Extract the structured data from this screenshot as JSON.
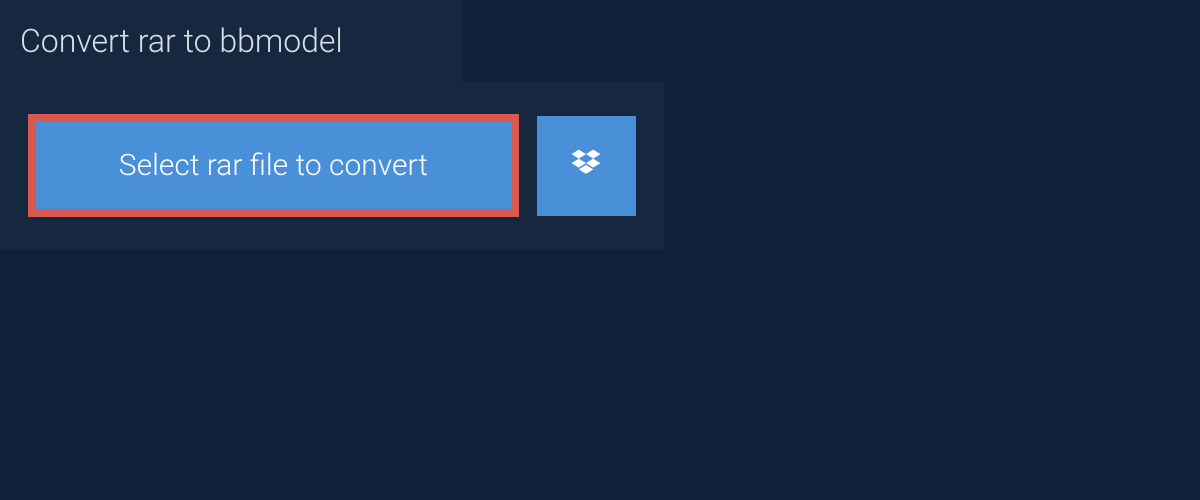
{
  "header": {
    "title": "Convert rar to bbmodel"
  },
  "upload": {
    "select_label": "Select rar file to convert"
  },
  "colors": {
    "background": "#0f2139",
    "panel": "#16283f",
    "button": "#4a90d9",
    "highlight_border": "#d9584f",
    "text_light": "#d8dfe6",
    "text_white": "#ffffff"
  }
}
